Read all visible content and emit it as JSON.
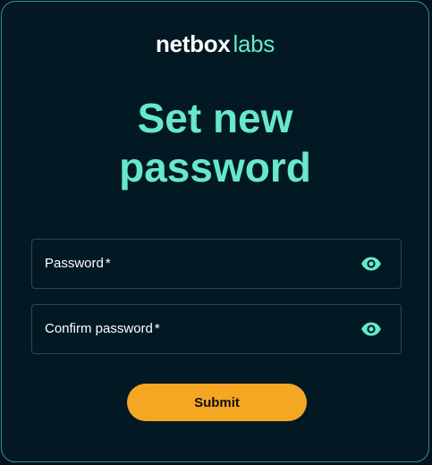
{
  "brand": {
    "part1": "netbox",
    "part2": "labs"
  },
  "heading": {
    "line1": "Set new",
    "line2": "password"
  },
  "fields": [
    {
      "label": "Password",
      "required_marker": "*",
      "icon": "eye-icon"
    },
    {
      "label": "Confirm password",
      "required_marker": "*",
      "icon": "eye-icon"
    }
  ],
  "submit": {
    "label": "Submit"
  },
  "colors": {
    "background": "#021923",
    "accent": "#67e8c9",
    "button": "#f5a623",
    "border": "#3e8d84"
  }
}
